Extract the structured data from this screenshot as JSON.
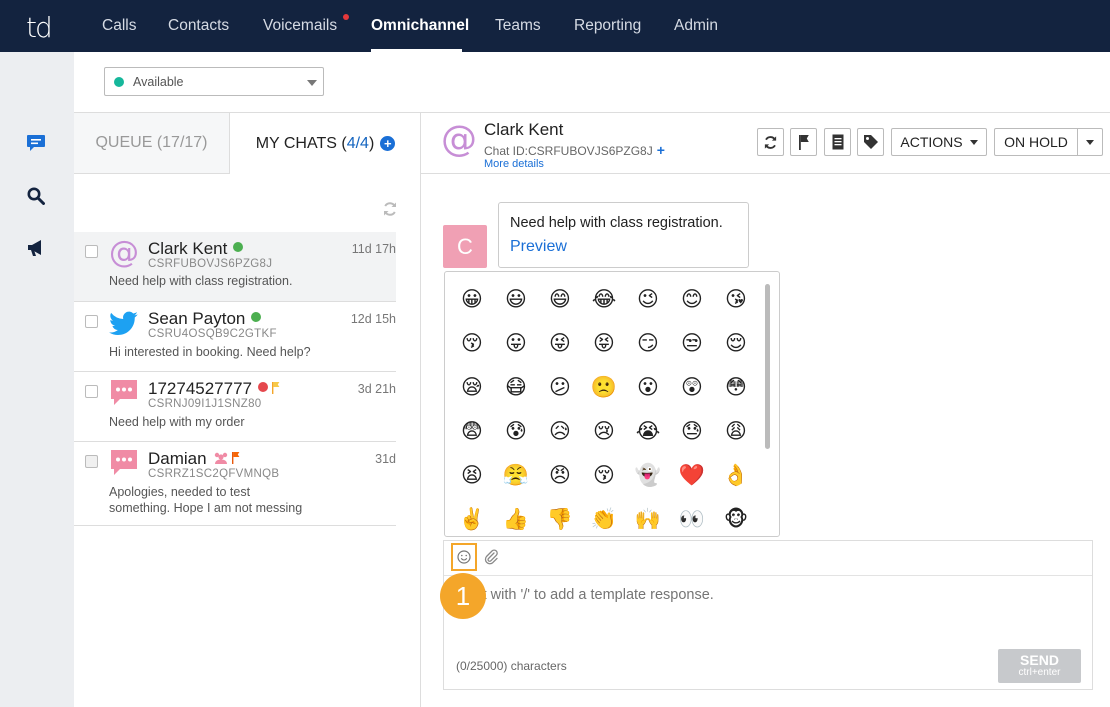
{
  "nav": {
    "logo": "td",
    "items": [
      "Calls",
      "Contacts",
      "Voicemails",
      "Omnichannel",
      "Teams",
      "Reporting",
      "Admin"
    ],
    "active": "Omnichannel"
  },
  "rail": {
    "icons": [
      "chat-icon",
      "search-icon",
      "megaphone-icon"
    ]
  },
  "status": {
    "value": "Available",
    "color": "#16b79b"
  },
  "tabs": {
    "queue": "QUEUE (17/17)",
    "mine_prefix": "MY CHATS (",
    "mine_count": "4/4",
    "mine_suffix": ")"
  },
  "chats": [
    {
      "name": "Clark Kent",
      "id": "CSRFUBOVJS6PZG8J",
      "message": "Need help with class registration.",
      "time": "11d 17h",
      "channel": "email"
    },
    {
      "name": "Sean Payton",
      "id": "CSRU4OSQB9C2GTKF",
      "message": "Hi interested in booking. Need help?",
      "time": "12d 15h",
      "channel": "twitter"
    },
    {
      "name": "17274527777",
      "id": "CSRNJ09I1J1SNZ80",
      "message": "Need help with my order",
      "time": "3d 21h",
      "channel": "sms"
    },
    {
      "name": "Damian",
      "id": "CSRRZ1SC2QFVMNQB",
      "message": "Apologies, needed to test something. Hope I am not messing",
      "time": "31d",
      "channel": "sms"
    }
  ],
  "conversation": {
    "name": "Clark Kent",
    "chat_id": "Chat ID:CSRFUBOVJS6PZG8J",
    "more_details": "More details",
    "actions_label": "ACTIONS",
    "onhold_label": "ON HOLD",
    "avatar_letter": "C",
    "message": "Need help with class registration.",
    "preview_link": "Preview"
  },
  "emojis": [
    "😀",
    "😃",
    "😄",
    "😂",
    "😉",
    "😊",
    "😘",
    "😚",
    "😛",
    "😜",
    "😝",
    "😏",
    "😒",
    "😌",
    "😪",
    "😷",
    "😕",
    "🙁",
    "😮",
    "😲",
    "😳",
    "😨",
    "😰",
    "😥",
    "😢",
    "😭",
    "😓",
    "😩",
    "😫",
    "😤",
    "😠",
    "😚",
    "👻",
    "❤️",
    "👌",
    "✌️",
    "👍",
    "👎",
    "👏",
    "🙌",
    "👀",
    "🐵"
  ],
  "composer": {
    "placeholder": "Start with '/' to add a template response.",
    "char_count": "(0/25000) characters",
    "send_label": "SEND",
    "send_hint": "ctrl+enter"
  },
  "step_badge": "1"
}
